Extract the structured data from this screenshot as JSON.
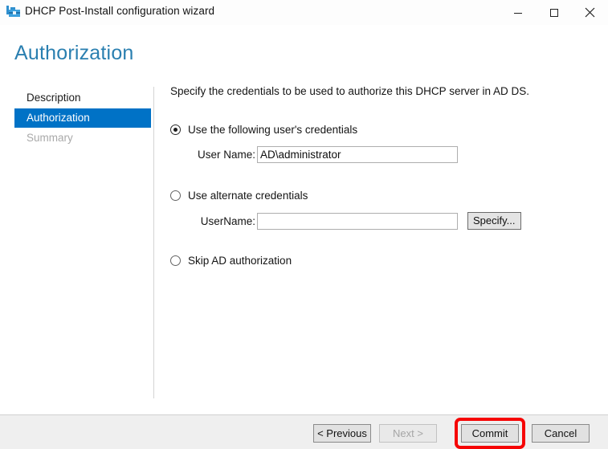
{
  "window": {
    "title": "DHCP Post-Install configuration wizard",
    "icon": "toolbox-icon",
    "controls": {
      "minimize": "minimize-icon",
      "maximize": "maximize-icon",
      "close": "close-icon"
    }
  },
  "page": {
    "header": "Authorization"
  },
  "nav": {
    "items": [
      {
        "label": "Description",
        "state": "visited"
      },
      {
        "label": "Authorization",
        "state": "active"
      },
      {
        "label": "Summary",
        "state": "disabled"
      }
    ]
  },
  "main": {
    "intro": "Specify the credentials to be used to authorize this DHCP server in AD DS.",
    "options": [
      {
        "label": "Use the following user's credentials",
        "selected": true,
        "field_label": "User Name:",
        "field_value": "AD\\administrator",
        "field_placeholder": ""
      },
      {
        "label": "Use alternate credentials",
        "selected": false,
        "field_label": "UserName:",
        "field_value": "",
        "field_placeholder": "",
        "button_label": "Specify..."
      },
      {
        "label": "Skip AD authorization",
        "selected": false
      }
    ]
  },
  "footer": {
    "buttons": [
      {
        "label": "< Previous",
        "enabled": true
      },
      {
        "label": "Next >",
        "enabled": false
      },
      {
        "label": "Commit",
        "enabled": true,
        "highlighted": true
      },
      {
        "label": "Cancel",
        "enabled": true
      }
    ]
  },
  "annotation": {
    "color": "#f60505",
    "target": "Commit"
  }
}
